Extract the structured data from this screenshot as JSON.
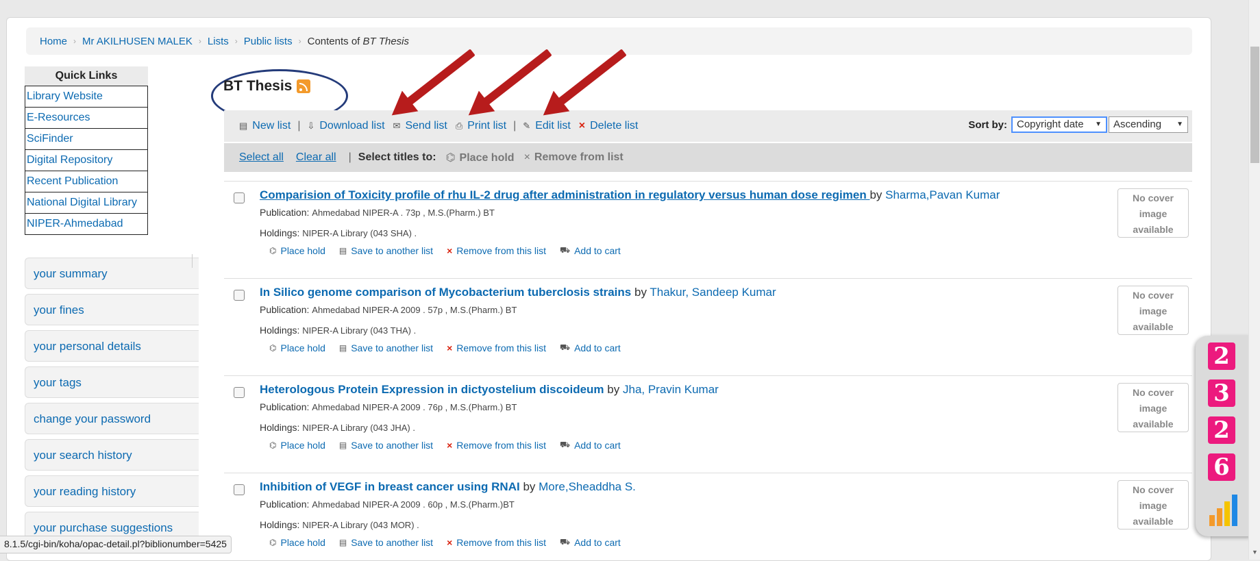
{
  "breadcrumb": {
    "home": "Home",
    "user": "Mr AKILHUSEN MALEK",
    "lists": "Lists",
    "public_lists": "Public lists",
    "current_prefix": "Contents of",
    "current_name": "BT Thesis"
  },
  "quick_links": {
    "heading": "Quick Links",
    "items": [
      "Library Website",
      "E-Resources",
      "SciFinder",
      "Digital Repository",
      "Recent Publication",
      "National Digital Library",
      "NIPER-Ahmedabad"
    ]
  },
  "user_menu": [
    "your summary",
    "your fines",
    "your personal details",
    "your tags",
    "change your password",
    "your search history",
    "your reading history",
    "your purchase suggestions"
  ],
  "list": {
    "title": "BT Thesis"
  },
  "toolbar": {
    "new_list": "New list",
    "download_list": "Download list",
    "send_list": "Send list",
    "print_list": "Print list",
    "edit_list": "Edit list",
    "delete_list": "Delete list",
    "sort_label": "Sort by:",
    "sort_field": "Copyright date",
    "sort_order": "Ascending",
    "separator": "|"
  },
  "selection_bar": {
    "select_all": "Select all",
    "clear_all": "Clear all",
    "select_titles": "Select titles to:",
    "place_hold": "Place hold",
    "remove_from_list": "Remove from list"
  },
  "record_labels": {
    "by": "by",
    "publication": "Publication:",
    "holdings": "Holdings:",
    "place_hold": "Place hold",
    "save_to_list": "Save to another list",
    "remove": "Remove from this list",
    "add_to_cart": "Add to cart",
    "no_cover_1": "No cover",
    "no_cover_2": "image",
    "no_cover_3": "available"
  },
  "records": [
    {
      "title": "Comparision of Toxicity profile of rhu IL-2 drug after administration in regulatory versus human dose regimen ",
      "author": "Sharma,Pavan Kumar",
      "publication": "Ahmedabad NIPER-A . 73p , M.S.(Pharm.) BT",
      "holdings": "NIPER-A Library (043 SHA) ."
    },
    {
      "title": "In Silico genome comparison of Mycobacterium tuberclosis strains",
      "author": "Thakur, Sandeep Kumar",
      "publication": "Ahmedabad NIPER-A 2009 . 57p , M.S.(Pharm.) BT",
      "holdings": "NIPER-A Library (043 THA) ."
    },
    {
      "title": "Heterologous Protein Expression in dictyostelium discoideum",
      "author": "Jha, Pravin Kumar",
      "publication": "Ahmedabad NIPER-A 2009 . 76p , M.S.(Pharm.) BT",
      "holdings": "NIPER-A Library (043 JHA) ."
    },
    {
      "title": "Inhibition of VEGF in breast cancer using RNAI",
      "author": "More,Sheaddha S.",
      "publication": "Ahmedabad NIPER-A 2009 . 60p , M.S.(Pharm.)BT",
      "holdings": "NIPER-A Library (043 MOR) ."
    }
  ],
  "visitor_counter": {
    "digits": [
      "2",
      "3",
      "2",
      "6"
    ]
  },
  "status_bar": "8.1.5/cgi-bin/koha/opac-detail.pl?biblionumber=5425",
  "colors": {
    "link": "#0c6ab1",
    "arrow": "#b71c1c",
    "oval": "#243b7a",
    "counter_digit": "#ec1a7e",
    "rss": "#f39a2b",
    "delete_x": "#d9230f"
  }
}
